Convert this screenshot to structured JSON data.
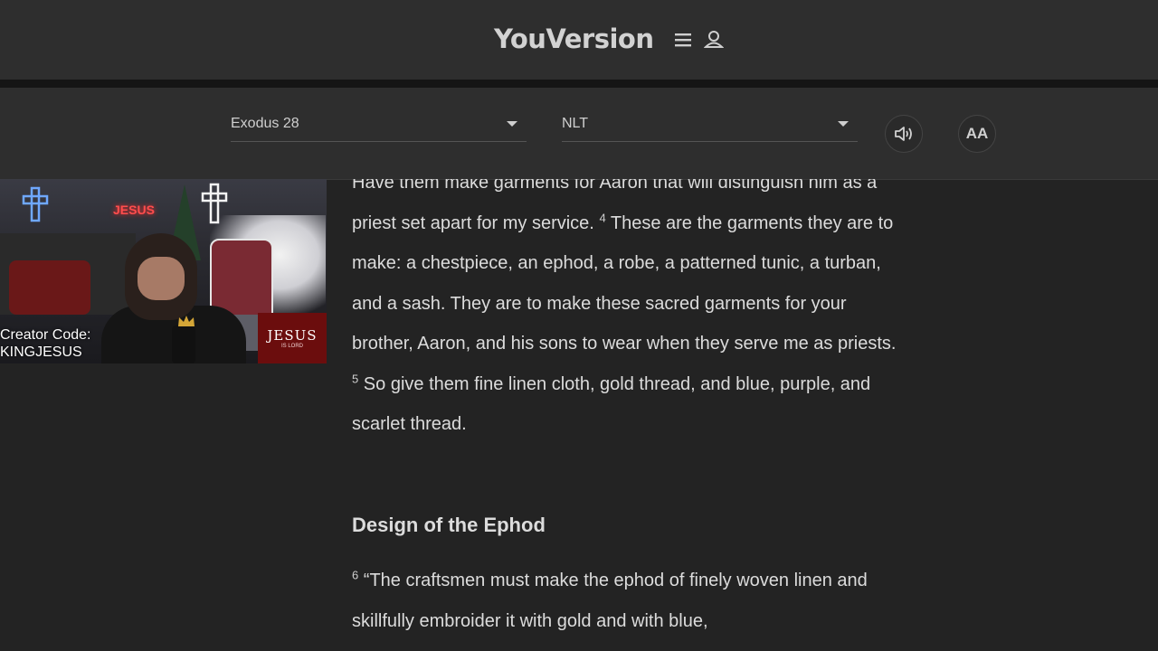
{
  "header": {
    "logo": "YouVersion",
    "icons": [
      "menu-icon",
      "user-icon"
    ]
  },
  "toolbar": {
    "book_chapter": "Exodus 28",
    "version": "NLT",
    "font_button": "AA",
    "audio_icon": "speaker-icon"
  },
  "passage": {
    "line_a": "Have them make garments for Aaron that will distinguish him as a priest set apart for my service.",
    "v4_num": "4",
    "v4_text": "These are the garments they are to make: a chestpiece, an ephod, a robe, a patterned tunic, a turban, and a sash. They are to make these sacred garments for your brother, Aaron, and his sons to wear when they serve me as priests.",
    "v5_num": "5",
    "v5_text": "So give them fine linen cloth, gold thread, and blue, purple, and scarlet thread.",
    "heading": "Design of the Ephod",
    "v6_num": "6",
    "v6_text": "“The craftsmen must make the ephod of finely woven linen and skillfully embroider it with gold and with blue,"
  },
  "overlay": {
    "creator_label": "Creator Code:",
    "creator_code": "KINGJESUS",
    "neon_sign": "JESUS",
    "badge_big": "JESUS",
    "badge_small": "IS LORD"
  }
}
